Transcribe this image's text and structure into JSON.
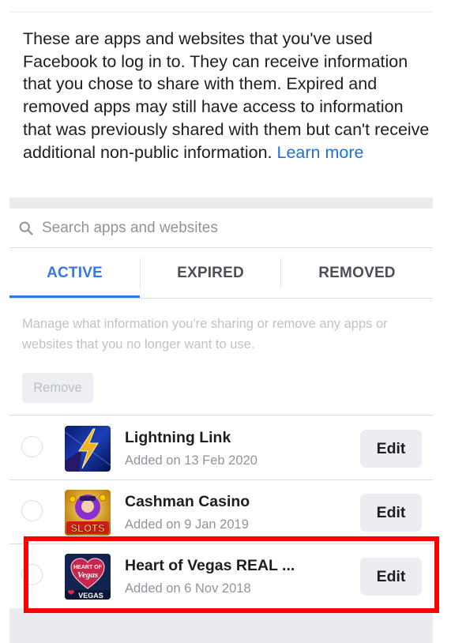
{
  "intro": {
    "text": "These are apps and websites that you've used Facebook to log in to. They can receive information that you chose to share with them. Expired and removed apps may still have access to information that was previously shared with them but can't receive additional non-public information.",
    "learn_more": "Learn more"
  },
  "search": {
    "placeholder": "Search apps and websites",
    "value": ""
  },
  "tabs": [
    {
      "label": "ACTIVE",
      "active": true
    },
    {
      "label": "EXPIRED",
      "active": false
    },
    {
      "label": "REMOVED",
      "active": false
    }
  ],
  "manage_text": "Manage what information you're sharing or remove any apps or websites that you no longer want to use.",
  "remove_label": "Remove",
  "apps": [
    {
      "name": "Lightning Link",
      "date": "Added on 13 Feb 2020",
      "edit": "Edit",
      "selected": false
    },
    {
      "name": "Cashman Casino",
      "date": "Added on 9 Jan 2019",
      "edit": "Edit",
      "selected": false,
      "icon_text": "SLOTS"
    },
    {
      "name": "Heart of Vegas REAL ...",
      "date": "Added on 6 Nov 2018",
      "edit": "Edit",
      "selected": false,
      "icon_text_top": "HEART OF",
      "icon_text_mid": "Vegas",
      "icon_text_bottom": "VEGAS",
      "highlighted": true
    }
  ],
  "colors": {
    "accent": "#3578e5",
    "link": "#216fdb",
    "highlight": "#ff0000"
  }
}
